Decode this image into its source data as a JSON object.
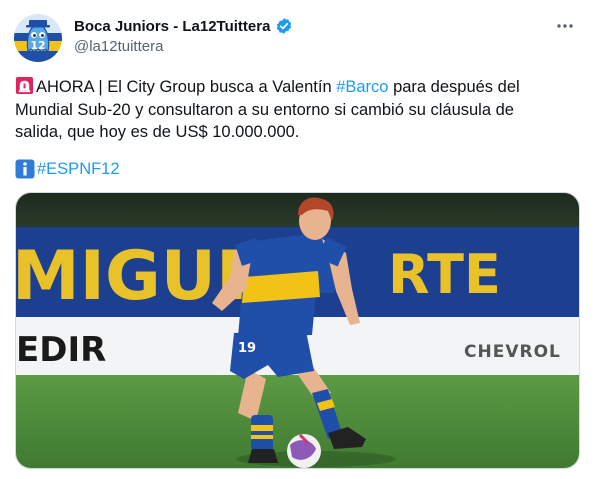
{
  "tweet": {
    "author": {
      "display_name": "Boca Juniors - La12Tuittera",
      "handle": "@la12tuittera",
      "verified": true,
      "avatar_icon": "boca-ghost-avatar-icon",
      "avatar_text": "12"
    },
    "text": {
      "line1_pre": "AHORA | El City Group busca a Valentín ",
      "line1_hashtag": "#Barco",
      "line1_post": " para después del",
      "line2": "Mundial Sub-20 y consultaron a su entorno si cambió su cláusula de",
      "line3": "salida, que hoy es de US$ 10.000.000."
    },
    "tag_line": {
      "icon": "information-icon",
      "hashtag": "#ESPNF12"
    },
    "alarm_icon": "rotating-light-icon",
    "more_icon": "more-options-icon",
    "media": {
      "banner_text_top": "MIGUE",
      "banner_text_right": "RTE",
      "ad_text_left": "EDIR",
      "ad_text_right": "CHEVROL",
      "jersey_number": "19"
    },
    "colors": {
      "link": "#1d9bf0",
      "text": "#0f1419",
      "muted": "#536471",
      "boca_blue": "#1f4fa8",
      "boca_gold": "#f2c316",
      "pitch": "#4f8a3a"
    }
  }
}
